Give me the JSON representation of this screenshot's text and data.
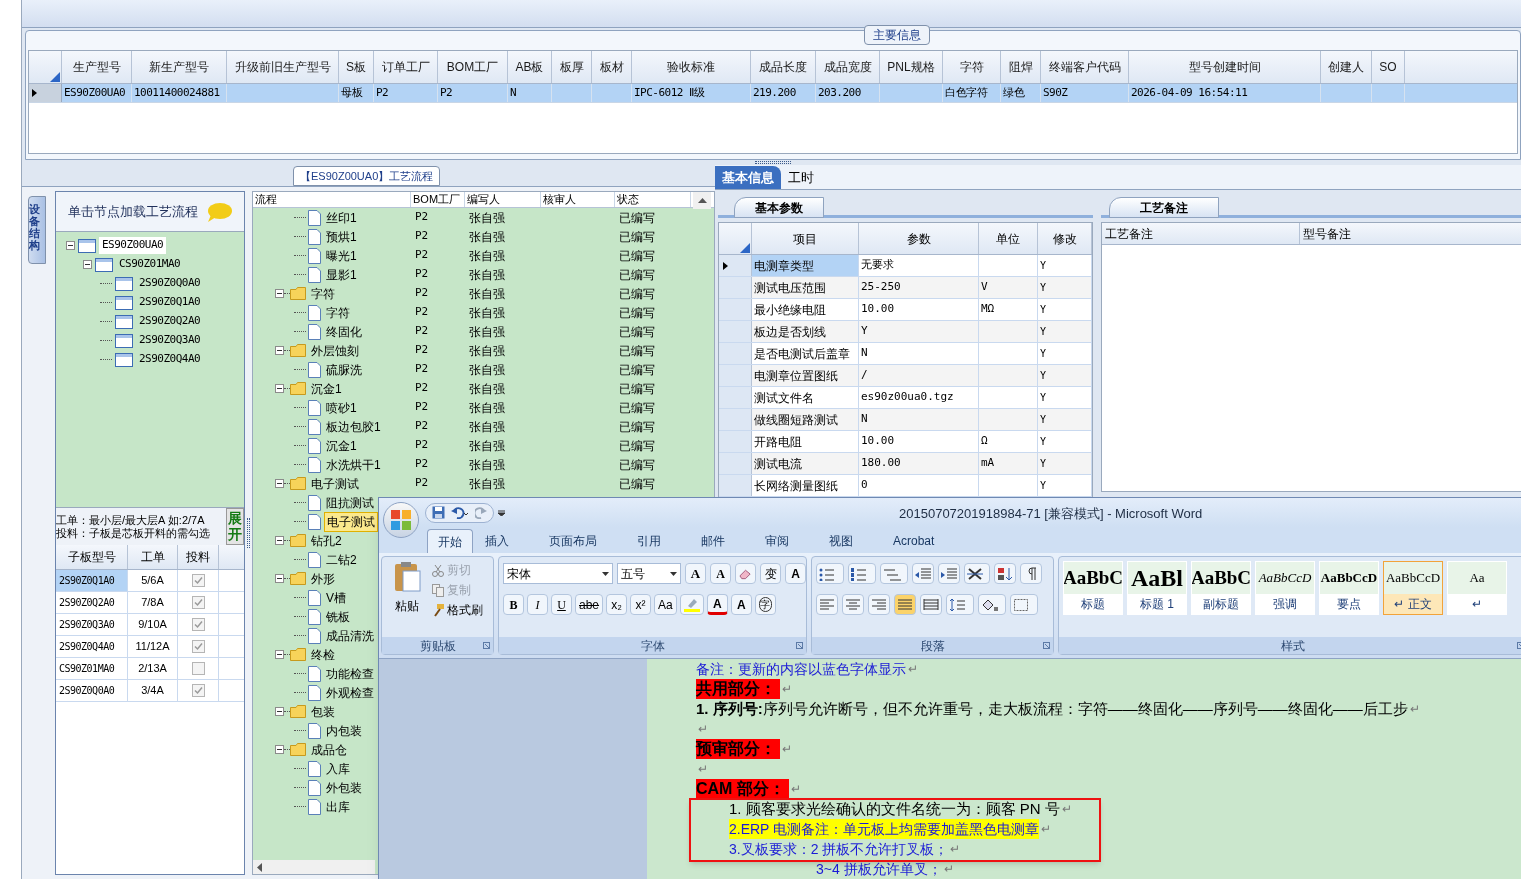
{
  "app": {
    "main_info": {
      "title": "主要信息",
      "row_selected": true,
      "columns": [
        {
          "label": "生产型号",
          "value": "ES90Z00UA0"
        },
        {
          "label": "新生产型号",
          "value": "10011400024881"
        },
        {
          "label": "升级前旧生产型号"
        },
        {
          "label": "S板",
          "value": "母板"
        },
        {
          "label": "订单工厂",
          "value": "P2"
        },
        {
          "label": "BOM工厂",
          "value": "P2"
        },
        {
          "label": "AB板",
          "value": "N"
        },
        {
          "label": "板厚"
        },
        {
          "label": "板材"
        },
        {
          "label": "验收标准",
          "value": "IPC-6012 Ⅱ级"
        },
        {
          "label": "成品长度",
          "value": "219.200"
        },
        {
          "label": "成品宽度",
          "value": "203.200"
        },
        {
          "label": "PNL规格"
        },
        {
          "label": "字符",
          "value": "白色字符"
        },
        {
          "label": "阻焊",
          "value": "绿色"
        },
        {
          "label": "终端客户代码",
          "value": "S90Z"
        },
        {
          "label": "型号创建时间",
          "value": "2026-04-09 16:54:11"
        },
        {
          "label": "创建人"
        },
        {
          "label": "SO"
        }
      ]
    },
    "process_tab": {
      "title": "【ES90Z00UA0】工艺流程"
    },
    "side_tab": {
      "label": "设备结构"
    },
    "structure_panel": {
      "hint": "单击节点加载工艺流程",
      "tree": [
        {
          "label": "ES90Z00UA0",
          "selected": true,
          "expanded": true,
          "children": [
            {
              "label": "CS90Z01MA0",
              "selected": false,
              "expanded": true,
              "children": [
                {
                  "label": "2S90Z0Q0A0",
                  "selected": false
                },
                {
                  "label": "2S90Z0Q1A0",
                  "selected": false
                },
                {
                  "label": "2S90Z0Q2A0",
                  "selected": false
                },
                {
                  "label": "2S90Z0Q3A0",
                  "selected": false
                },
                {
                  "label": "2S90Z0Q4A0",
                  "selected": false
                }
              ]
            }
          ]
        }
      ],
      "notes": [
        "工单：最小层/最大层A 如:2/7A",
        "投料：子板是芯板开料的需勾选"
      ],
      "expand_button": "展开",
      "grid": {
        "columns": [
          "子板型号",
          "工单",
          "投料"
        ],
        "rows": [
          {
            "model": "2S90Z0Q1A0",
            "order": "5/6A",
            "feed": true,
            "selected": true
          },
          {
            "model": "2S90Z0Q2A0",
            "order": "7/8A",
            "feed": true,
            "selected": false
          },
          {
            "model": "2S90Z0Q3A0",
            "order": "9/10A",
            "feed": true,
            "selected": false
          },
          {
            "model": "2S90Z0Q4A0",
            "order": "11/12A",
            "feed": true,
            "selected": false
          },
          {
            "model": "CS90Z01MA0",
            "order": "2/13A",
            "feed": false,
            "selected": false
          },
          {
            "model": "2S90Z0Q0A0",
            "order": "3/4A",
            "feed": true,
            "selected": false
          }
        ]
      }
    },
    "process_tree": {
      "columns": [
        "流程",
        "BOM工厂",
        "编写人",
        "核审人",
        "状态"
      ],
      "nodes": [
        {
          "kind": "file",
          "name": "丝印1",
          "bom": "P2",
          "author": "张自强",
          "status": "已编写",
          "selected": false
        },
        {
          "kind": "file",
          "name": "预烘1",
          "bom": "P2",
          "author": "张自强",
          "status": "已编写",
          "selected": false
        },
        {
          "kind": "file",
          "name": "曝光1",
          "bom": "P2",
          "author": "张自强",
          "status": "已编写",
          "selected": false
        },
        {
          "kind": "file",
          "name": "显影1",
          "bom": "P2",
          "author": "张自强",
          "status": "已编写",
          "selected": false
        },
        {
          "kind": "folder",
          "name": "字符",
          "bom": "P2",
          "author": "张自强",
          "status": "已编写",
          "selected": false,
          "expanded": true,
          "children": [
            {
              "kind": "file",
              "name": "字符",
              "bom": "P2",
              "author": "张自强",
              "status": "已编写",
              "selected": false
            },
            {
              "kind": "file",
              "name": "终固化",
              "bom": "P2",
              "author": "张自强",
              "status": "已编写",
              "selected": false
            }
          ]
        },
        {
          "kind": "folder",
          "name": "外层蚀刻",
          "bom": "P2",
          "author": "张自强",
          "status": "已编写",
          "selected": false,
          "expanded": true,
          "children": [
            {
              "kind": "file",
              "name": "硫脲洗",
              "bom": "P2",
              "author": "张自强",
              "status": "已编写",
              "selected": false
            }
          ]
        },
        {
          "kind": "folder",
          "name": "沉金1",
          "bom": "P2",
          "author": "张自强",
          "status": "已编写",
          "selected": false,
          "expanded": true,
          "children": [
            {
              "kind": "file",
              "name": "喷砂1",
              "bom": "P2",
              "author": "张自强",
              "status": "已编写",
              "selected": false
            },
            {
              "kind": "file",
              "name": "板边包胶1",
              "bom": "P2",
              "author": "张自强",
              "status": "已编写",
              "selected": false
            },
            {
              "kind": "file",
              "name": "沉金1",
              "bom": "P2",
              "author": "张自强",
              "status": "已编写",
              "selected": false
            },
            {
              "kind": "file",
              "name": "水洗烘干1",
              "bom": "P2",
              "author": "张自强",
              "status": "已编写",
              "selected": false
            }
          ]
        },
        {
          "kind": "folder",
          "name": "电子测试",
          "bom": "P2",
          "author": "张自强",
          "status": "已编写",
          "selected": false,
          "expanded": true,
          "children": [
            {
              "kind": "file",
              "name": "阻抗测试",
              "selected": false
            },
            {
              "kind": "file",
              "name": "电子测试",
              "selected": true
            }
          ]
        },
        {
          "kind": "folder",
          "name": "钻孔2",
          "selected": false,
          "expanded": true,
          "children": [
            {
              "kind": "file",
              "name": "二钻2",
              "selected": false
            }
          ]
        },
        {
          "kind": "folder",
          "name": "外形",
          "selected": false,
          "expanded": true,
          "children": [
            {
              "kind": "file",
              "name": "V槽",
              "selected": false
            },
            {
              "kind": "file",
              "name": "铣板",
              "selected": false
            },
            {
              "kind": "file",
              "name": "成品清洗",
              "selected": false
            }
          ]
        },
        {
          "kind": "folder",
          "name": "终检",
          "selected": false,
          "expanded": true,
          "children": [
            {
              "kind": "file",
              "name": "功能检查",
              "selected": false
            },
            {
              "kind": "file",
              "name": "外观检查",
              "selected": false
            }
          ]
        },
        {
          "kind": "folder",
          "name": "包装",
          "selected": false,
          "expanded": true,
          "children": [
            {
              "kind": "file",
              "name": "内包装",
              "selected": false
            }
          ]
        },
        {
          "kind": "folder",
          "name": "成品仓",
          "selected": false,
          "expanded": true,
          "children": [
            {
              "kind": "file",
              "name": "入库",
              "selected": false
            },
            {
              "kind": "file",
              "name": "外包装",
              "selected": false
            },
            {
              "kind": "file",
              "name": "出库",
              "selected": false
            }
          ]
        }
      ]
    },
    "detail_tabs": [
      {
        "label": "基本信息",
        "selected": true
      },
      {
        "label": "工时",
        "selected": false
      }
    ],
    "params": {
      "tab": "基本参数",
      "columns": [
        "项目",
        "参数",
        "单位",
        "修改"
      ],
      "rows": [
        {
          "item": "电测章类型",
          "value": "无要求",
          "edit": "Y",
          "selected": true
        },
        {
          "item": "测试电压范围",
          "value": "25-250",
          "unit": "V",
          "edit": "Y",
          "selected": false
        },
        {
          "item": "最小绝缘电阻",
          "value": "10.00",
          "unit": "MΩ",
          "edit": "Y",
          "selected": false
        },
        {
          "item": "板边是否划线",
          "value": "Y",
          "edit": "Y",
          "selected": false
        },
        {
          "item": "是否电测试后盖章",
          "value": "N",
          "edit": "Y",
          "selected": false
        },
        {
          "item": "电测章位置图纸",
          "value": "/",
          "edit": "Y",
          "selected": false
        },
        {
          "item": "测试文件名",
          "value": "es90z00ua0.tgz",
          "edit": "Y",
          "selected": false
        },
        {
          "item": "做线圈短路测试",
          "value": "N",
          "edit": "Y",
          "selected": false
        },
        {
          "item": "开路电阻",
          "value": "10.00",
          "unit": "Ω",
          "edit": "Y",
          "selected": false
        },
        {
          "item": "测试电流",
          "value": "180.00",
          "unit": "mA",
          "edit": "Y",
          "selected": false
        },
        {
          "item": "长网络测量图纸",
          "value": "0",
          "edit": "Y",
          "selected": false
        }
      ]
    },
    "remarks": {
      "tab": "工艺备注",
      "columns": [
        "工艺备注",
        "型号备注"
      ]
    }
  },
  "word": {
    "title": "20150707201918984-71 [兼容模式] - Microsoft Word",
    "tabs": [
      {
        "label": "开始",
        "selected": true
      },
      {
        "label": "插入",
        "selected": false
      },
      {
        "label": "页面布局",
        "selected": false
      },
      {
        "label": "引用",
        "selected": false
      },
      {
        "label": "邮件",
        "selected": false
      },
      {
        "label": "审阅",
        "selected": false
      },
      {
        "label": "视图",
        "selected": false
      },
      {
        "label": "Acrobat",
        "selected": false
      }
    ],
    "clipboard": {
      "title": "剪贴板",
      "paste": "粘贴",
      "items": [
        {
          "label": "剪切",
          "disabled": true
        },
        {
          "label": "复制",
          "disabled": true
        },
        {
          "label": "格式刷",
          "disabled": false
        }
      ]
    },
    "font": {
      "title": "字体",
      "name": "宋体",
      "size": "五号",
      "row1": [
        {
          "kind": "grow",
          "text": "A"
        },
        {
          "kind": "shrink",
          "text": "A"
        },
        {
          "kind": "clear"
        },
        {
          "kind": "phonetic",
          "text": "变"
        },
        {
          "kind": "border",
          "text": "A"
        }
      ],
      "row2": [
        {
          "kind": "bold",
          "text": "B"
        },
        {
          "kind": "italic",
          "text": "I"
        },
        {
          "kind": "underline",
          "text": "U"
        },
        {
          "kind": "strike",
          "text": "abe"
        },
        {
          "kind": "sub",
          "text": "x₂"
        },
        {
          "kind": "sup",
          "text": "x²"
        },
        {
          "kind": "case",
          "text": "Aa"
        },
        {
          "kind": "highlight"
        },
        {
          "kind": "color",
          "text": "A"
        },
        {
          "kind": "shade",
          "text": "A"
        },
        {
          "kind": "enclose",
          "text": "字"
        }
      ]
    },
    "paragraph": {
      "title": "段落"
    },
    "styles": {
      "title": "样式",
      "items": [
        {
          "kind": "heading",
          "preview": "AaBbC",
          "label": "标题",
          "selected": false
        },
        {
          "kind": "title",
          "preview": "AaBl",
          "label": "标题 1",
          "selected": false
        },
        {
          "kind": "heading",
          "preview": "AaBbC",
          "label": "副标题",
          "selected": false
        },
        {
          "kind": "emphasis",
          "preview": "AaBbCcD",
          "label": "强调",
          "selected": false
        },
        {
          "kind": "strong",
          "preview": "AaBbCcD",
          "label": "要点",
          "selected": false
        },
        {
          "kind": "normal",
          "preview": "AaBbCcD",
          "label": "↵ 正文",
          "selected": true
        },
        {
          "kind": "normal",
          "preview": "Aa",
          "label": "↵",
          "selected": false
        }
      ]
    },
    "document": [
      {
        "kind": "note",
        "text": "备注：更新的内容以蓝色字体显示",
        "mark": "↵"
      },
      {
        "kind": "heading",
        "text": "共用部分：",
        "mark": "↵"
      },
      {
        "kind": "body",
        "text": "**1. 序列号:**序列号允许断号，但不允许重号，走大板流程：字符——终固化——序列号——终固化——后工步",
        "mark": "↵"
      },
      {
        "kind": "blank",
        "mark": "↵"
      },
      {
        "kind": "heading",
        "text": "预审部分：",
        "mark": "↵"
      },
      {
        "kind": "blank",
        "mark": "↵"
      },
      {
        "kind": "heading",
        "text": "CAM 部分：",
        "mark": "↵"
      },
      {
        "kind": "list",
        "text": "1. 顾客要求光绘确认的文件名统一为：顾客 PN 号",
        "mark": "↵"
      },
      {
        "kind": "list-highlight",
        "text": "2.ERP 电测备注：单元板上均需要加盖黑色电测章",
        "mark": "↵"
      },
      {
        "kind": "list-blue",
        "text": "3.叉板要求：2 拼板不允许打叉板；",
        "mark": "↵"
      },
      {
        "kind": "continuation-blue",
        "text": "3~4 拼板允许单叉；",
        "mark": "↵"
      }
    ]
  }
}
